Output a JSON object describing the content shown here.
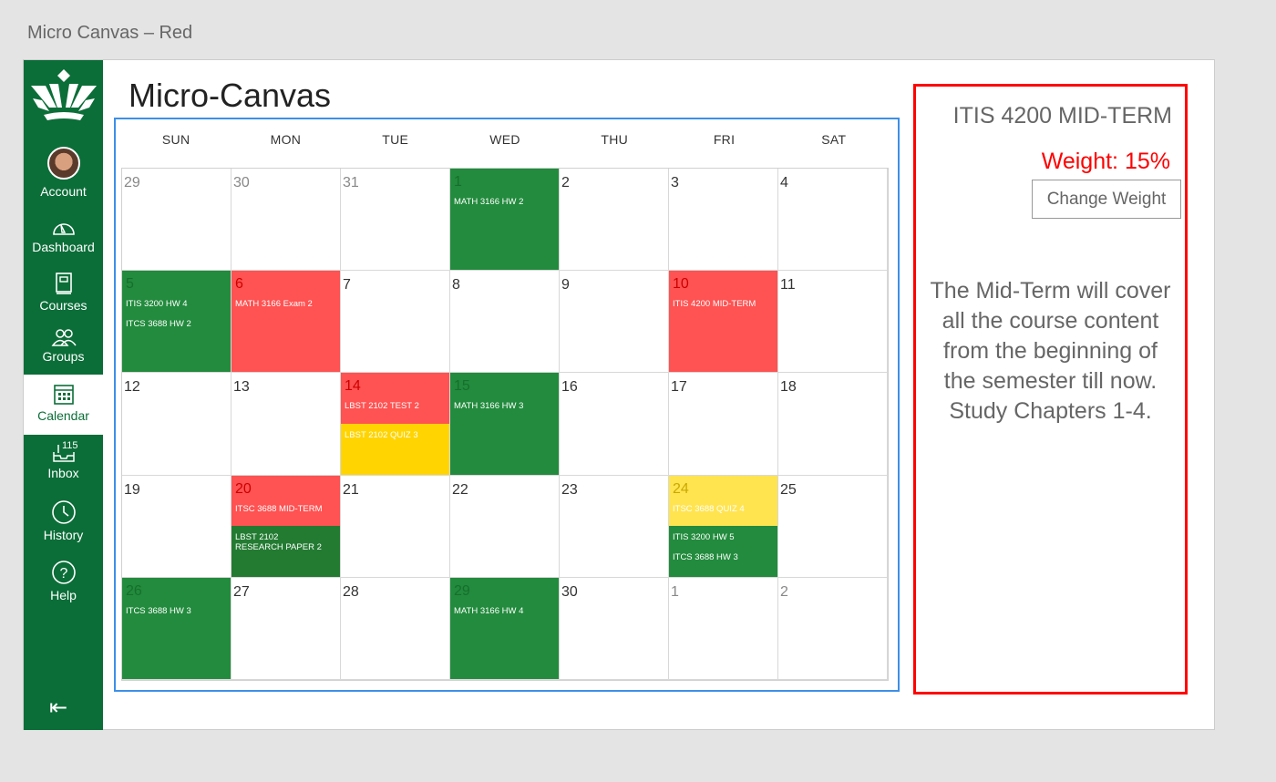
{
  "window_title": "Micro Canvas – Red",
  "app_title": "Micro-Canvas",
  "sidebar": {
    "items": [
      {
        "label": "Account",
        "icon": "avatar"
      },
      {
        "label": "Dashboard",
        "icon": "dashboard-icon"
      },
      {
        "label": "Courses",
        "icon": "book-icon"
      },
      {
        "label": "Groups",
        "icon": "groups-icon"
      },
      {
        "label": "Calendar",
        "icon": "calendar-icon",
        "active": true
      },
      {
        "label": "Inbox",
        "icon": "inbox-icon",
        "badge": "115"
      },
      {
        "label": "History",
        "icon": "clock-icon"
      },
      {
        "label": "Help",
        "icon": "help-icon"
      }
    ],
    "collapse_icon": "collapse-icon"
  },
  "colors": {
    "green": "#228b3d",
    "red": "#ff5252",
    "yellow": "#ffd400",
    "lightyellow": "#ffe450",
    "darkgreen": "#237b32"
  },
  "calendar": {
    "days_of_week": [
      "SUN",
      "MON",
      "TUE",
      "WED",
      "THU",
      "FRI",
      "SAT"
    ],
    "days": [
      {
        "n": "29",
        "muted": true
      },
      {
        "n": "30",
        "muted": true
      },
      {
        "n": "31",
        "muted": true
      },
      {
        "n": "1",
        "segs": [
          {
            "c": "green",
            "ev": [
              "MATH 3166 HW 2"
            ]
          }
        ]
      },
      {
        "n": "2"
      },
      {
        "n": "3"
      },
      {
        "n": "4"
      },
      {
        "n": "5",
        "segs": [
          {
            "c": "green",
            "ev": [
              "ITIS 3200 HW 4",
              "ITCS 3688 HW 2"
            ]
          }
        ]
      },
      {
        "n": "6",
        "segs": [
          {
            "c": "red",
            "ev": [
              "MATH 3166 Exam 2"
            ]
          }
        ]
      },
      {
        "n": "7"
      },
      {
        "n": "8"
      },
      {
        "n": "9"
      },
      {
        "n": "10",
        "segs": [
          {
            "c": "red",
            "ev": [
              "ITIS 4200 MID-TERM"
            ]
          }
        ]
      },
      {
        "n": "11"
      },
      {
        "n": "12"
      },
      {
        "n": "13"
      },
      {
        "n": "14",
        "segs": [
          {
            "c": "red",
            "ev": [
              "LBST 2102 TEST 2"
            ]
          },
          {
            "c": "yellow",
            "ev": [
              "LBST 2102 QUIZ 3"
            ]
          }
        ]
      },
      {
        "n": "15",
        "segs": [
          {
            "c": "green",
            "ev": [
              "MATH 3166 HW 3"
            ]
          }
        ]
      },
      {
        "n": "16"
      },
      {
        "n": "17"
      },
      {
        "n": "18"
      },
      {
        "n": "19"
      },
      {
        "n": "20",
        "segs": [
          {
            "c": "red",
            "ev": [
              "ITSC 3688 MID-TERM"
            ]
          },
          {
            "c": "darkgreen",
            "ev": [
              "LBST 2102\nRESEARCH PAPER 2"
            ]
          }
        ]
      },
      {
        "n": "21"
      },
      {
        "n": "22"
      },
      {
        "n": "23"
      },
      {
        "n": "24",
        "segs": [
          {
            "c": "lightyellow",
            "ev": [
              "ITSC 3688 QUIZ 4"
            ]
          },
          {
            "c": "green",
            "ev": [
              "ITIS 3200 HW 5",
              "ITCS 3688 HW 3"
            ]
          }
        ]
      },
      {
        "n": "25"
      },
      {
        "n": "26",
        "segs": [
          {
            "c": "green",
            "ev": [
              "ITCS 3688 HW 3"
            ]
          }
        ]
      },
      {
        "n": "27"
      },
      {
        "n": "28"
      },
      {
        "n": "29",
        "segs": [
          {
            "c": "green",
            "ev": [
              "MATH 3166 HW 4"
            ]
          }
        ]
      },
      {
        "n": "30"
      },
      {
        "n": "1",
        "muted": true
      },
      {
        "n": "2",
        "muted": true
      }
    ]
  },
  "detail": {
    "title": "ITIS 4200 MID-TERM",
    "weight": "Weight: 15%",
    "change_button": "Change Weight",
    "description": "The Mid-Term will cover all the course content from the beginning of the semester till now. Study Chapters 1-4."
  }
}
